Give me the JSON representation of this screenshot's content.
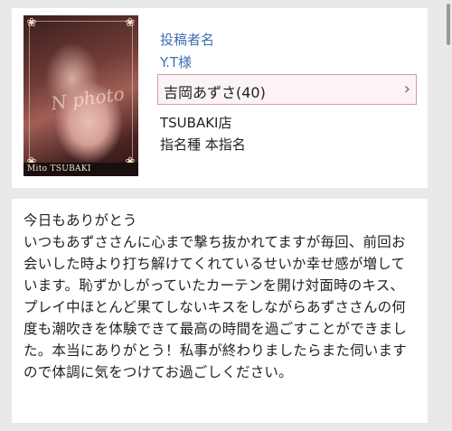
{
  "poster": {
    "label": "投稿者名",
    "name": "Y.T様"
  },
  "cast": {
    "name": "吉岡あずさ(40)",
    "chevron_icon": "chevron-right-icon"
  },
  "store": "TSUBAKI店",
  "nomination": "指名種 本指名",
  "photo": {
    "watermark": "N photo",
    "caption": "Mito TSUBAKI"
  },
  "review": {
    "text": "今日もありがとう\nいつもあずささんに心まで撃ち抜かれてますが毎回、前回お会いした時より打ち解けてくれているせいか幸せ感が増しています。恥ずかしがっていたカーテンを開け対面時のキス、プレイ中ほとんど果てしないキスをしながらあずささんの何度も潮吹きを体験できて最高の時間を過ごすことができました。本当にありがとう！私事が終わりましたらまた伺いますので体調に気をつけてお過ごしください。"
  },
  "colors": {
    "link": "#3e6fb3",
    "cast_border": "#d59ab0",
    "cast_bg": "#fbf3f6",
    "page_bg": "#e9e9e9"
  }
}
